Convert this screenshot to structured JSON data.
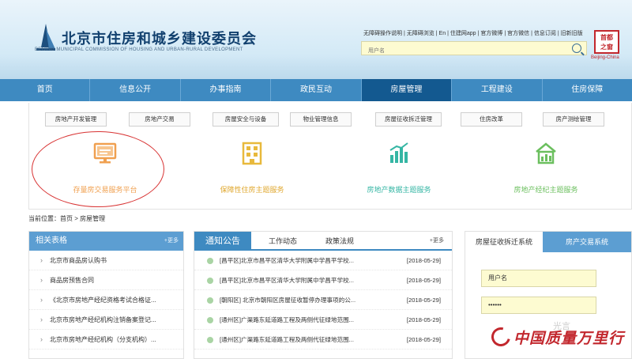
{
  "header": {
    "title": "北京市住房和城乡建设委员会",
    "subtitle": "BEIJING MUNICIPAL COMMISSION OF HOUSING AND URBAN-RURAL DEVELOPMENT",
    "top_links": [
      "无障碍操作说明",
      "无障碍浏览",
      "En",
      "住建网app",
      "官方微博",
      "官方微信",
      "信息订阅",
      "旧新旧版"
    ],
    "search_placeholder": "用户名",
    "seal_line1": "首都",
    "seal_line2": "之窗",
    "seal_caption": "Beijing-China"
  },
  "nav": {
    "items": [
      "首页",
      "信息公开",
      "办事指南",
      "政民互动",
      "房屋管理",
      "工程建设",
      "住房保障"
    ],
    "active_index": 4
  },
  "subnav": {
    "buttons": [
      "房地产开发管理",
      "房地产交易",
      "房屋安全与设备",
      "物业管理信息",
      "房屋征收拆迁管理",
      "住房改革",
      "房产测绘管理"
    ],
    "features": [
      {
        "label": "存量房交易服务平台",
        "icon": "monitor-icon",
        "color": "#f0a050"
      },
      {
        "label": "保障性住房主题服务",
        "icon": "building-icon",
        "color": "#e8b93c"
      },
      {
        "label": "房地产数据主题服务",
        "icon": "bar-chart-icon",
        "color": "#35b6a4"
      },
      {
        "label": "房地产经纪主题服务",
        "icon": "house-chart-icon",
        "color": "#6bbf5e"
      }
    ]
  },
  "breadcrumb": "当前位置：首页 > 房屋管理",
  "left_panel": {
    "title": "相关表格",
    "more": "+更多",
    "items": [
      "北京市商品房认购书",
      "商品房预售合同",
      "《北京市房地产经纪资格考试合格证...",
      "北京市房地产经纪机构注销备案登记...",
      "北京市房地产经纪机构（分支机构）..."
    ]
  },
  "center_panel": {
    "tabs": [
      "通知公告",
      "工作动态",
      "政策法规"
    ],
    "more": "+更多",
    "news": [
      {
        "title": "[昌平区]北京市昌平区清华大学附属中学昌平学校...",
        "date": "[2018-05-29]"
      },
      {
        "title": "[昌平区]北京市昌平区清华大学附属中学昌平学校...",
        "date": "[2018-05-29]"
      },
      {
        "title": "[朝阳区] 北京市朝阳区房屋征收暂停办理事项的公...",
        "date": "[2018-05-29]"
      },
      {
        "title": "[通州区]广渠路东延道路工程及两侧代征绿地范围...",
        "date": "[2018-05-29]"
      },
      {
        "title": "[通州区]广渠路东延道路工程及两侧代征绿地范围...",
        "date": "[2018-05-29]"
      }
    ]
  },
  "right_panel": {
    "tabs": [
      "房屋征收拆迁系统",
      "房产交易系统"
    ],
    "username_placeholder": "用户名",
    "password_value": "••••••"
  },
  "watermark": {
    "text": "中国质量万里行",
    "faint_text": "光言"
  },
  "colors": {
    "nav": "#3e8ac1",
    "nav_active": "#135990",
    "panel_head": "#5c9ed2",
    "highlight": "#d83333"
  }
}
